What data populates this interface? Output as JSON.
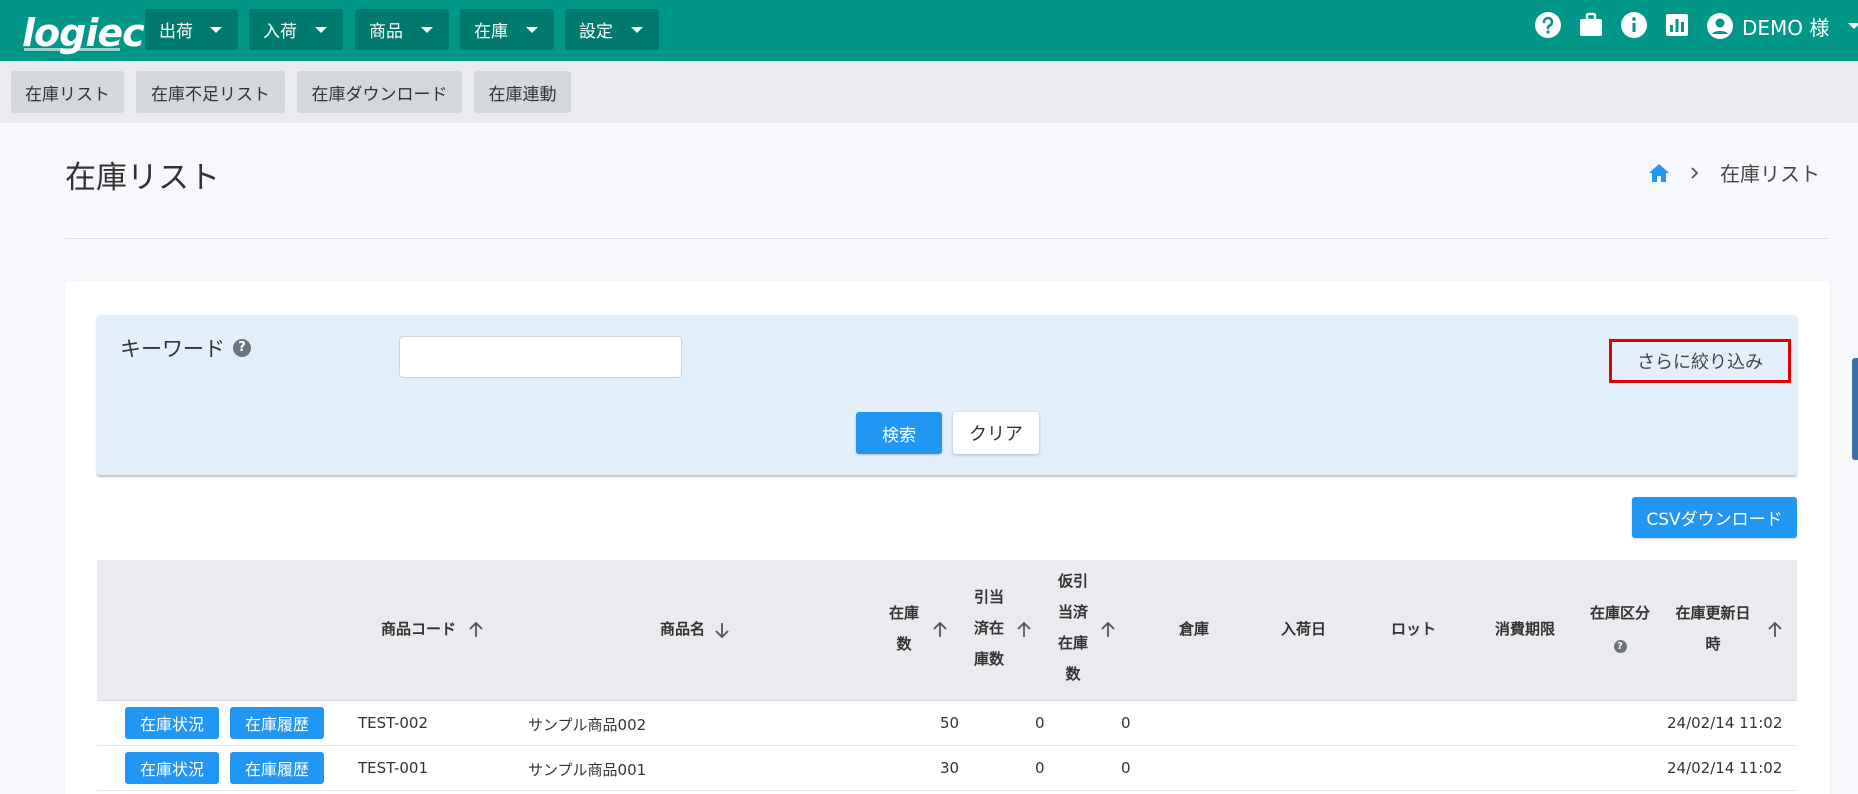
{
  "app": {
    "logo": "logiec"
  },
  "menu": [
    {
      "label": "出荷"
    },
    {
      "label": "入荷"
    },
    {
      "label": "商品"
    },
    {
      "label": "在庫"
    },
    {
      "label": "設定"
    }
  ],
  "user": {
    "name": "DEMO 様"
  },
  "subnav": [
    {
      "label": "在庫リスト"
    },
    {
      "label": "在庫不足リスト"
    },
    {
      "label": "在庫ダウンロード"
    },
    {
      "label": "在庫連動"
    }
  ],
  "page": {
    "title": "在庫リスト",
    "breadcrumb_current": "在庫リスト"
  },
  "search": {
    "keyword_label": "キーワード",
    "help_mark": "?",
    "keyword_value": "",
    "narrow_label": "さらに絞り込み",
    "search_label": "検索",
    "clear_label": "クリア"
  },
  "csv_label": "CSVダウンロード",
  "table": {
    "headers": {
      "code": "商品コード",
      "name": "商品名",
      "stock": [
        "在庫",
        "数"
      ],
      "allocated": [
        "引当",
        "済在",
        "庫数"
      ],
      "temp_allocated": [
        "仮引",
        "当済",
        "在庫",
        "数"
      ],
      "warehouse": "倉庫",
      "arrival": "入荷日",
      "lot": "ロット",
      "expiry": "消費期限",
      "category": "在庫区分",
      "category_help": "?",
      "updated": [
        "在庫更新日",
        "時"
      ]
    },
    "row_buttons": {
      "status": "在庫状況",
      "history": "在庫履歴"
    },
    "rows": [
      {
        "code": "TEST-002",
        "name": "サンプル商品002",
        "stock": "50",
        "allocated": "0",
        "temp_allocated": "0",
        "updated": "24/02/14 11:02"
      },
      {
        "code": "TEST-001",
        "name": "サンプル商品001",
        "stock": "30",
        "allocated": "0",
        "temp_allocated": "0",
        "updated": "24/02/14 11:02"
      }
    ]
  }
}
